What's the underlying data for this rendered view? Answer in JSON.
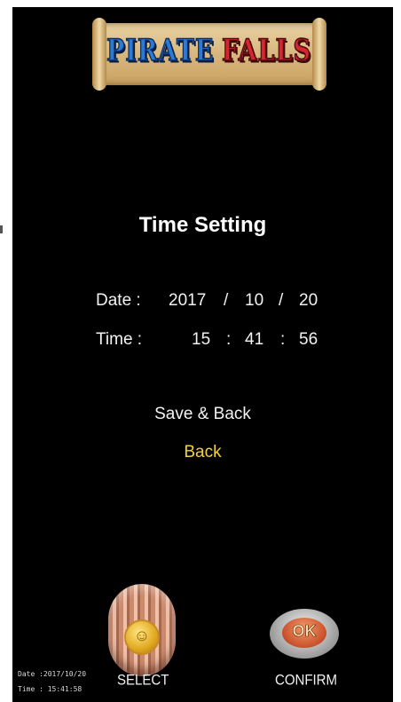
{
  "logo": {
    "word_left": "PIRATE",
    "word_right": "FALLS"
  },
  "title": "Time Setting",
  "date_row": {
    "label": "Date :",
    "year": "2017",
    "sep1": "/",
    "month": "10",
    "sep2": "/",
    "day": "20"
  },
  "time_row": {
    "label": "Time :",
    "hour": "15",
    "sep1": ":",
    "minute": "41",
    "sep2": ":",
    "second": "56"
  },
  "menu": {
    "save_back": "Save & Back",
    "back": "Back"
  },
  "buttons": {
    "select_label": "SELECT",
    "confirm_label": "CONFIRM",
    "ok_cap": "OK"
  },
  "status": {
    "date": "Date :2017/10/20",
    "time": "Time :  15:41:58"
  },
  "colors": {
    "background": "#000000",
    "text": "#f2f2f2",
    "highlight": "#f2d23a"
  },
  "icons": {
    "select_knob": "select-knob-icon",
    "ok_button": "ok-button-icon"
  }
}
